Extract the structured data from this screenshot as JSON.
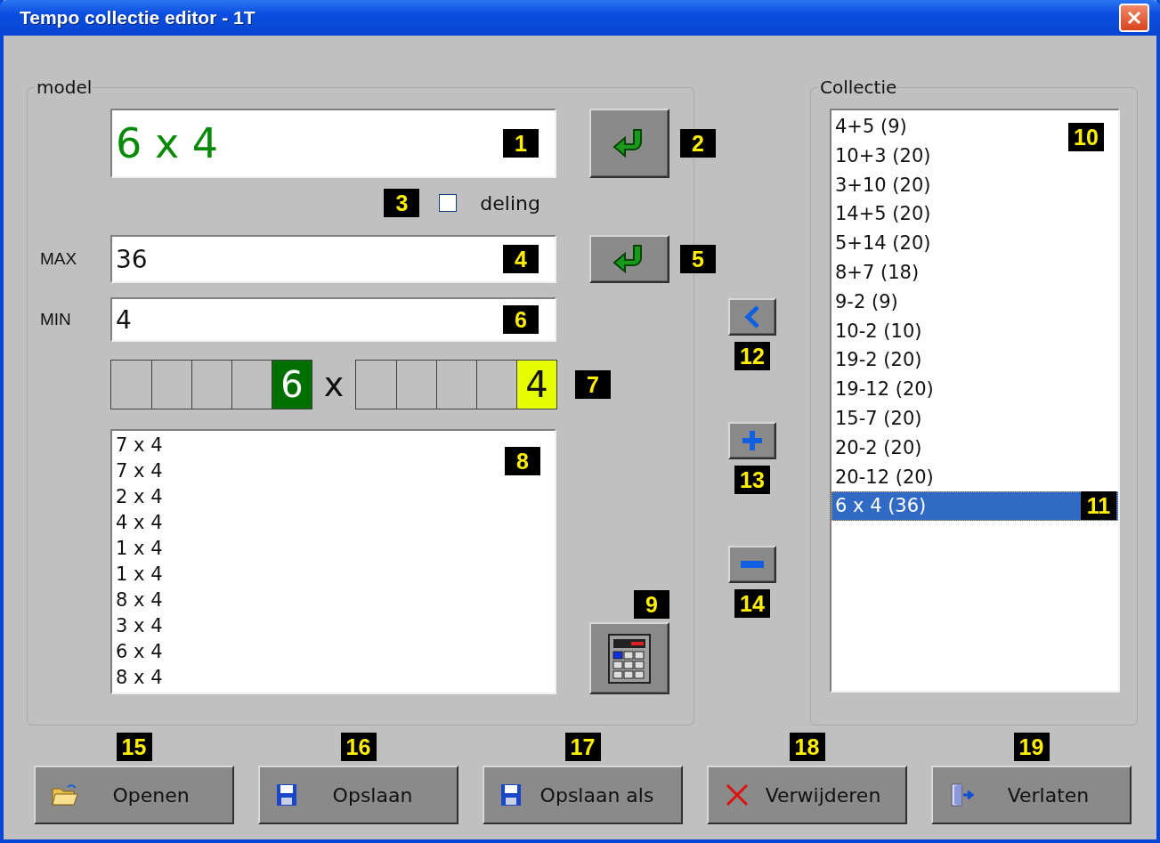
{
  "window": {
    "title": "Tempo collectie editor - 1T"
  },
  "model": {
    "legend": "model",
    "expression": {
      "value": "6 x 4",
      "badge": "1"
    },
    "apply_button": {
      "badge": "2"
    },
    "division": {
      "label": "deling",
      "checked": false,
      "badge": "3"
    },
    "max": {
      "label": "MAX",
      "value": "36",
      "badge": "4"
    },
    "max_apply_button": {
      "badge": "5"
    },
    "min": {
      "label": "MIN",
      "value": "4",
      "badge": "6"
    },
    "factors": {
      "left": {
        "digit": "6",
        "color": "#007000"
      },
      "operator": "x",
      "right": {
        "digit": "4",
        "color": "#e6ff00"
      },
      "badge": "7"
    },
    "results": {
      "badge": "8",
      "items": [
        "7 x 4",
        "7 x 4",
        "2 x 4",
        "4 x 4",
        "1 x 4",
        "1 x 4",
        "8 x 4",
        "3 x 4",
        "6 x 4",
        "8 x 4"
      ]
    },
    "calculator_button": {
      "badge": "9"
    }
  },
  "transfer_buttons": [
    {
      "kind": "back",
      "badge": "12"
    },
    {
      "kind": "add",
      "badge": "13"
    },
    {
      "kind": "remove",
      "badge": "14"
    }
  ],
  "collection": {
    "legend": "Collectie",
    "badge": "10",
    "items": [
      {
        "label": "4+5 (9)",
        "selected": false
      },
      {
        "label": "10+3 (20)",
        "selected": false
      },
      {
        "label": "3+10 (20)",
        "selected": false
      },
      {
        "label": "14+5 (20)",
        "selected": false
      },
      {
        "label": "5+14 (20)",
        "selected": false
      },
      {
        "label": "8+7 (18)",
        "selected": false
      },
      {
        "label": "9-2 (9)",
        "selected": false
      },
      {
        "label": "10-2 (10)",
        "selected": false
      },
      {
        "label": "19-2 (20)",
        "selected": false
      },
      {
        "label": "19-12 (20)",
        "selected": false
      },
      {
        "label": "15-7 (20)",
        "selected": false
      },
      {
        "label": "20-2 (20)",
        "selected": false
      },
      {
        "label": "20-12 (20)",
        "selected": false
      },
      {
        "label": "6 x 4 (36)",
        "selected": true,
        "badge": "11"
      }
    ]
  },
  "buttons": [
    {
      "kind": "open",
      "label": "Openen",
      "badge": "15"
    },
    {
      "kind": "save",
      "label": "Opslaan",
      "badge": "16"
    },
    {
      "kind": "save",
      "label": "Opslaan als",
      "badge": "17"
    },
    {
      "kind": "delete",
      "label": "Verwijderen",
      "badge": "18"
    },
    {
      "kind": "exit",
      "label": "Verlaten",
      "badge": "19"
    }
  ]
}
